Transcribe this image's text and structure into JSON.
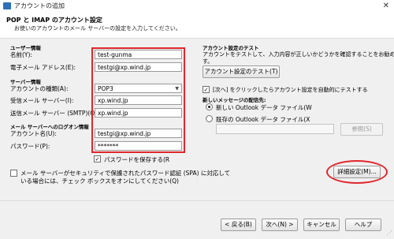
{
  "window": {
    "title": "アカウントの追加",
    "close_glyph": "✕"
  },
  "header": {
    "title": "POP と IMAP のアカウント設定",
    "subtitle": "お使いのアカウントのメール サーバーの設定を入力してください。"
  },
  "user_info": {
    "section": "ユーザー情報",
    "name_label": "名前(Y):",
    "name_value": "test-gunma",
    "email_label": "電子メール アドレス(E):",
    "email_value": "testgi@xp.wind.jp"
  },
  "server_info": {
    "section": "サーバー情報",
    "account_type_label": "アカウントの種類(A):",
    "account_type_value": "POP3",
    "incoming_label": "受信メール サーバー(I):",
    "incoming_value": "xp.wind.jp",
    "outgoing_label": "送信メール サーバー (SMTP)(O):",
    "outgoing_value": "xp.wind.jp"
  },
  "logon_info": {
    "section": "メール サーバーへのログオン情報",
    "account_name_label": "アカウント名(U):",
    "account_name_value": "testgi@xp.wind.jp",
    "password_label": "パスワード(P):",
    "password_value": "*******",
    "remember_password_label": "パスワードを保存する(R",
    "remember_password_checked": true
  },
  "spa": {
    "label_line1": "メール サーバーがセキュリティで保護されたパスワード認証 (SPA) に対応して",
    "label_line2": "いる場合には、チェック ボックスをオンにしてください(Q)",
    "checked": false
  },
  "test_section": {
    "title": "アカウント設定のテスト",
    "desc_line1": "アカウントをテストして、入力内容が正しいかどうかを確認することをお勧めしま",
    "desc_line2": "す。",
    "test_button": "アカウント設定のテスト(T)",
    "auto_test_label": "[次へ] をクリックしたらアカウント設定を自動的にテストする",
    "auto_test_checked": true
  },
  "delivery": {
    "title": "新しいメッセージの配信先:",
    "new_file_label": "新しい Outlook データ ファイル(W",
    "existing_file_label": "既存の Outlook データ ファイル(X",
    "selected": "new",
    "browse_button": "参照(S)"
  },
  "more_settings_button": "詳細設定(M)...",
  "footer": {
    "back": "< 戻る(B)",
    "next": "次へ(N) >",
    "cancel": "キャンセル",
    "help": "ヘルプ"
  },
  "colors": {
    "highlight": "#e0262d",
    "accent": "#2d6fb8"
  },
  "icons": [
    "app-icon",
    "close-icon",
    "dropdown-arrow-icon",
    "resize-grip-icon"
  ]
}
